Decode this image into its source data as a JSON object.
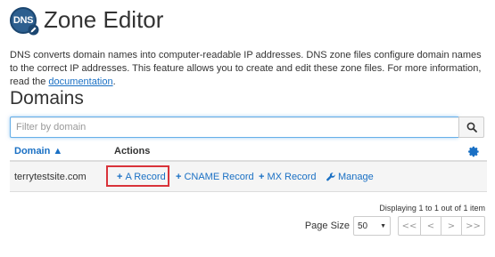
{
  "header": {
    "logo_text": "DNS",
    "title": "Zone Editor"
  },
  "description": {
    "text": "DNS converts domain names into computer-readable IP addresses. DNS zone files configure domain names to the correct IP addresses. This feature allows you to create and edit these zone files. For more information, read the ",
    "link_text": "documentation",
    "suffix": "."
  },
  "domains": {
    "title": "Domains",
    "filter_placeholder": "Filter by domain",
    "columns": {
      "domain": "Domain ▲",
      "actions": "Actions"
    },
    "rows": [
      {
        "domain": "terrytestsite.com",
        "actions": {
          "a_record": "A Record",
          "cname_record": "CNAME Record",
          "mx_record": "MX Record",
          "manage": "Manage"
        }
      }
    ],
    "plus": "+",
    "display_info": "Displaying 1 to 1 out of 1 item",
    "page_size_label": "Page Size",
    "page_size_value": "50",
    "pager": {
      "first": "<<",
      "prev": "<",
      "next": ">",
      "last": ">>"
    }
  },
  "colors": {
    "link": "#1a70c4",
    "highlight": "#d9333a",
    "logo_bg": "#2d5f8f"
  }
}
